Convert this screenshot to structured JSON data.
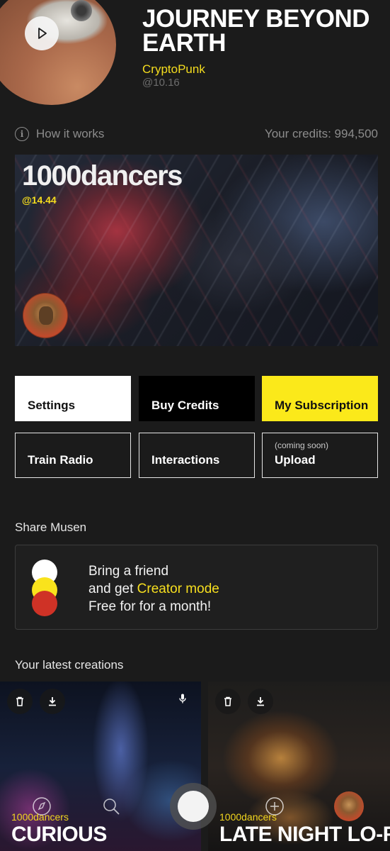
{
  "header": {
    "title": "JOURNEY BEYOND EARTH",
    "author": "CryptoPunk",
    "time": "@10.16"
  },
  "info": {
    "how_it_works": "How it works",
    "credits": "Your credits: 994,500"
  },
  "featured": {
    "title": "1000dancers",
    "time": "@14.44"
  },
  "buttons": {
    "settings": "Settings",
    "buy_credits": "Buy Credits",
    "my_subscription": "My Subscription",
    "train_radio": "Train Radio",
    "interactions": "Interactions",
    "upload_note": "(coming soon)",
    "upload": "Upload"
  },
  "share": {
    "label": "Share Musen",
    "line1": "Bring a friend",
    "line2_prefix": "and get ",
    "line2_highlight": "Creator mode",
    "line3": "Free for for a month!"
  },
  "creations": {
    "label": "Your latest creations",
    "items": [
      {
        "author": "1000dancers",
        "title": "CURIOUS"
      },
      {
        "author": "1000dancers",
        "title": "LATE NIGHT LO-F"
      }
    ]
  },
  "colors": {
    "accent": "#fbe91a",
    "background": "#1b1b1b",
    "danger_dot": "#cf3226"
  },
  "icons": [
    "play-icon",
    "info-icon",
    "trash-icon",
    "download-icon",
    "mic-icon",
    "compass-icon",
    "search-icon",
    "add-icon"
  ]
}
